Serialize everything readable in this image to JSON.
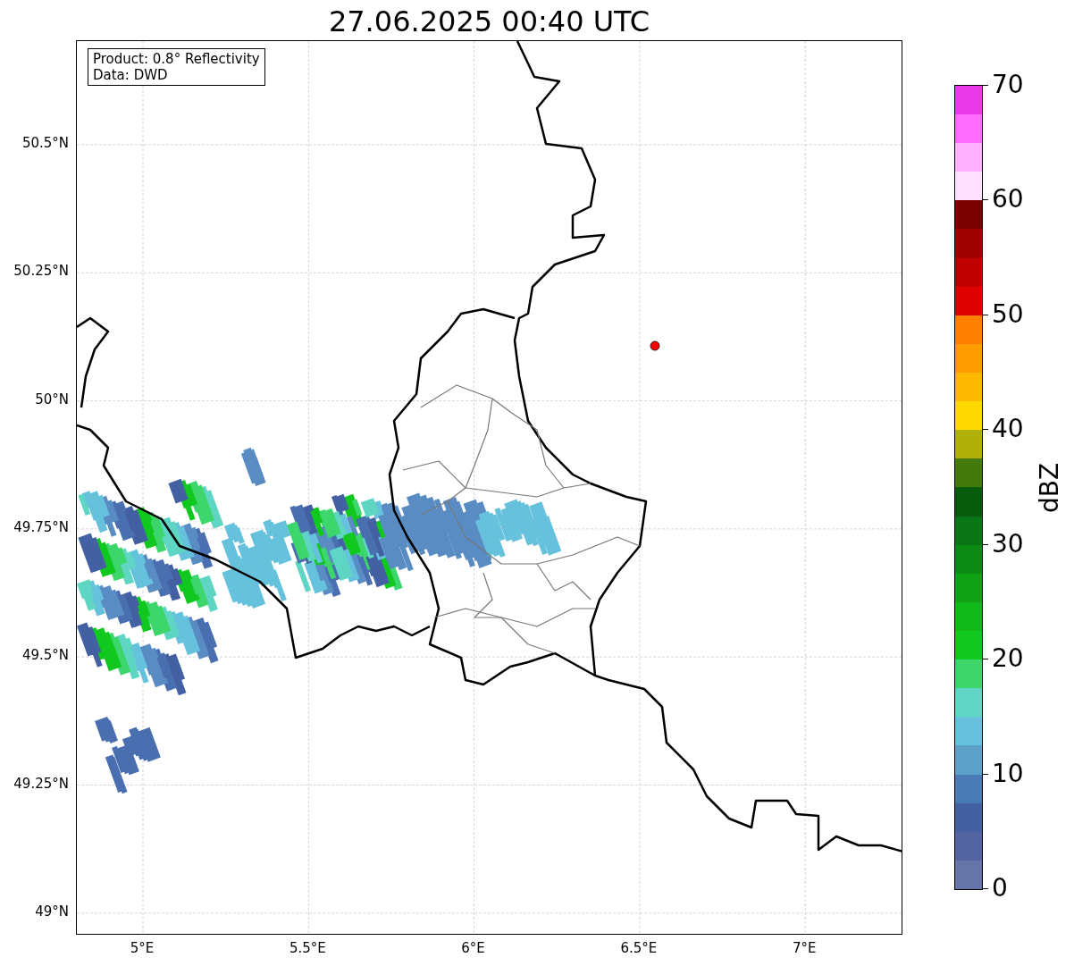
{
  "title": "27.06.2025 00:40 UTC",
  "info_box": {
    "lines": [
      "Product: 0.8° Reflectivity",
      "Data: DWD"
    ]
  },
  "map": {
    "lat_ticks": [
      "50.5°N",
      "50.25°N",
      "50°N",
      "49.75°N",
      "49.5°N",
      "49.25°N",
      "49°N"
    ],
    "lon_ticks": [
      "5°E",
      "5.5°E",
      "6°E",
      "6.5°E",
      "7°E"
    ]
  },
  "colorbar": {
    "label": "dBZ",
    "ticks": [
      "70",
      "60",
      "50",
      "40",
      "30",
      "20",
      "10",
      "0"
    ],
    "bands": [
      {
        "color": "#6674a8"
      },
      {
        "color": "#5464a0"
      },
      {
        "color": "#4360a3"
      },
      {
        "color": "#4a7ab5"
      },
      {
        "color": "#5ca0c8"
      },
      {
        "color": "#66c2dc"
      },
      {
        "color": "#5fd6c4"
      },
      {
        "color": "#3cd66c"
      },
      {
        "color": "#10c81e"
      },
      {
        "color": "#10b81a"
      },
      {
        "color": "#10a014"
      },
      {
        "color": "#0c8a14"
      },
      {
        "color": "#0a7514"
      },
      {
        "color": "#065c0c"
      },
      {
        "color": "#447a0c"
      },
      {
        "color": "#b0b008"
      },
      {
        "color": "#ffd800"
      },
      {
        "color": "#ffb800"
      },
      {
        "color": "#ff9c00"
      },
      {
        "color": "#ff8000"
      },
      {
        "color": "#e00000"
      },
      {
        "color": "#c00000"
      },
      {
        "color": "#a00000"
      },
      {
        "color": "#7a0000"
      },
      {
        "color": "#ffe0ff"
      },
      {
        "color": "#ffb0ff"
      },
      {
        "color": "#ff6cff"
      },
      {
        "color": "#e838e8"
      }
    ]
  }
}
